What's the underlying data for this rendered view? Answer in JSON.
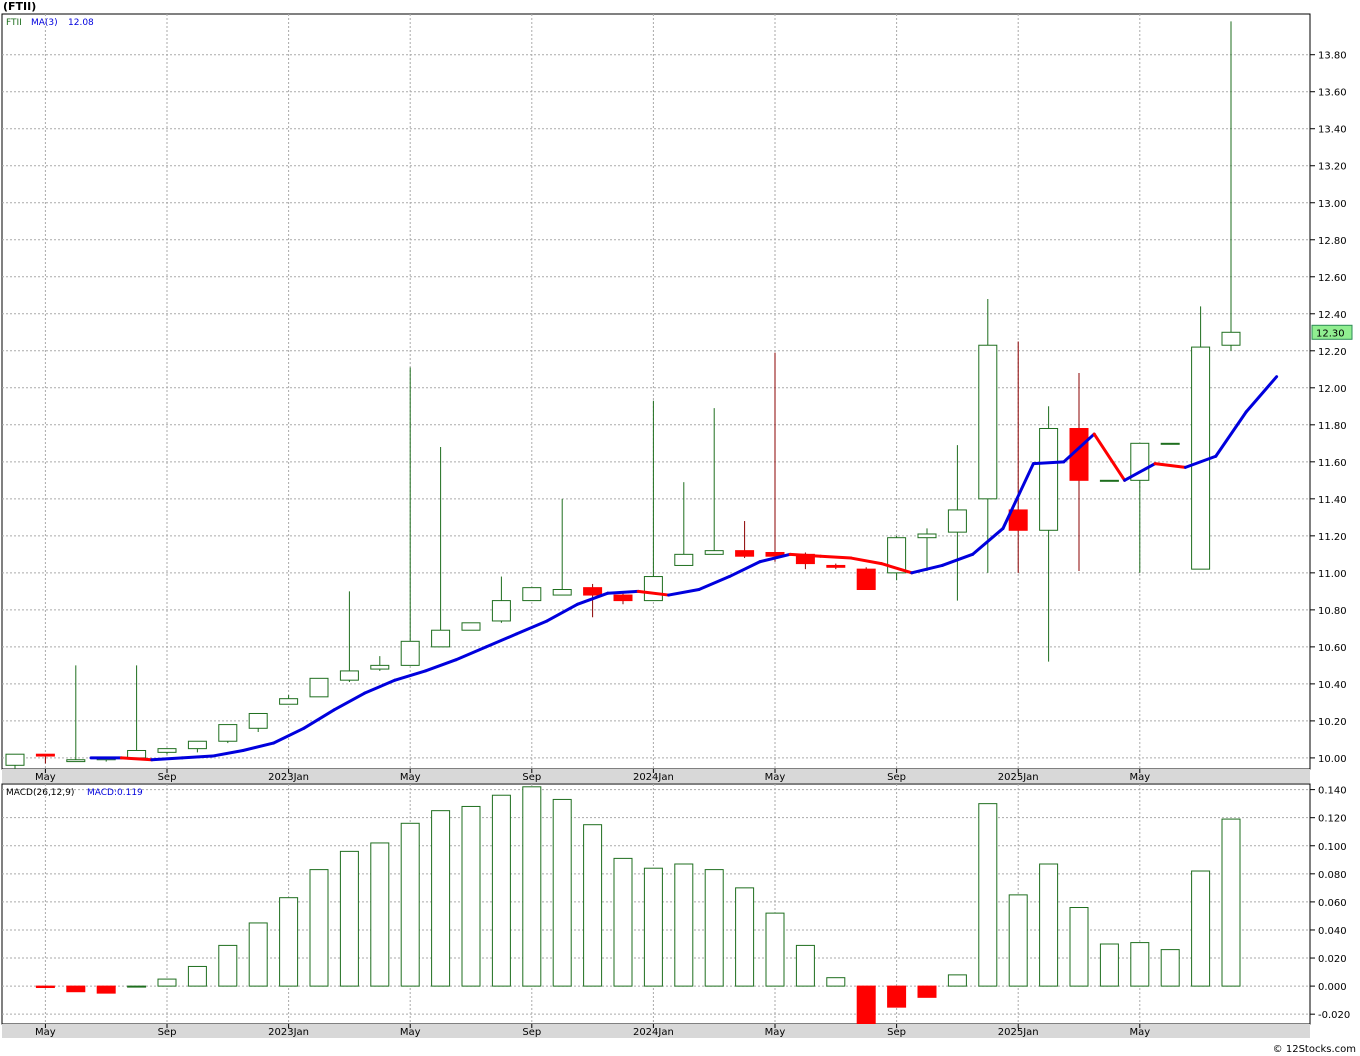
{
  "title": "(FTII)",
  "footer": "© 12Stocks.com",
  "colors": {
    "up_candle": "#1e6e1e",
    "down_candle": "#ff0000",
    "ma_up": "#0000dd",
    "ma_down": "#ff0000",
    "grid": "#aaaaaa",
    "axis_band": "#d8d8d8",
    "last_price_bg": "#90ee90"
  },
  "chart_data": [
    {
      "type": "candlestick",
      "legend": {
        "ticker": "FTII",
        "ma_label": "MA(3)",
        "ma_value": "12.08"
      },
      "last_price_label": "12.30",
      "ylim": [
        9.94,
        14.02
      ],
      "y_ticks": [
        10.0,
        10.2,
        10.4,
        10.6,
        10.8,
        11.0,
        11.2,
        11.4,
        11.6,
        11.8,
        12.0,
        12.2,
        12.4,
        12.6,
        12.8,
        13.0,
        13.2,
        13.4,
        13.6,
        13.8
      ],
      "x_labels": [
        {
          "label": "May",
          "index": 1
        },
        {
          "label": "Sep",
          "index": 5
        },
        {
          "label": "2023Jan",
          "index": 9
        },
        {
          "label": "May",
          "index": 13
        },
        {
          "label": "Sep",
          "index": 17
        },
        {
          "label": "2024Jan",
          "index": 21
        },
        {
          "label": "May",
          "index": 25
        },
        {
          "label": "Sep",
          "index": 29
        },
        {
          "label": "2025Jan",
          "index": 33
        },
        {
          "label": "May",
          "index": 37
        }
      ],
      "candles": [
        {
          "o": 9.96,
          "h": 10.02,
          "l": 9.94,
          "c": 10.02
        },
        {
          "o": 10.02,
          "h": 10.02,
          "l": 9.97,
          "c": 10.01
        },
        {
          "o": 9.98,
          "h": 10.5,
          "l": 9.98,
          "c": 9.99
        },
        {
          "o": 9.99,
          "h": 10.0,
          "l": 9.98,
          "c": 10.0
        },
        {
          "o": 10.0,
          "h": 10.5,
          "l": 10.0,
          "c": 10.04
        },
        {
          "o": 10.03,
          "h": 10.05,
          "l": 10.02,
          "c": 10.05
        },
        {
          "o": 10.05,
          "h": 10.09,
          "l": 10.03,
          "c": 10.09
        },
        {
          "o": 10.09,
          "h": 10.18,
          "l": 10.08,
          "c": 10.18
        },
        {
          "o": 10.16,
          "h": 10.24,
          "l": 10.14,
          "c": 10.24
        },
        {
          "o": 10.29,
          "h": 10.34,
          "l": 10.29,
          "c": 10.32
        },
        {
          "o": 10.33,
          "h": 10.43,
          "l": 10.33,
          "c": 10.43
        },
        {
          "o": 10.42,
          "h": 10.9,
          "l": 10.41,
          "c": 10.47
        },
        {
          "o": 10.48,
          "h": 10.55,
          "l": 10.47,
          "c": 10.5
        },
        {
          "o": 10.5,
          "h": 12.11,
          "l": 10.5,
          "c": 10.63
        },
        {
          "o": 10.6,
          "h": 11.68,
          "l": 10.6,
          "c": 10.69
        },
        {
          "o": 10.69,
          "h": 10.73,
          "l": 10.69,
          "c": 10.73
        },
        {
          "o": 10.74,
          "h": 10.98,
          "l": 10.73,
          "c": 10.85
        },
        {
          "o": 10.85,
          "h": 10.92,
          "l": 10.85,
          "c": 10.92
        },
        {
          "o": 10.88,
          "h": 11.4,
          "l": 10.88,
          "c": 10.91
        },
        {
          "o": 10.92,
          "h": 10.94,
          "l": 10.76,
          "c": 10.88
        },
        {
          "o": 10.88,
          "h": 10.9,
          "l": 10.83,
          "c": 10.85
        },
        {
          "o": 10.85,
          "h": 11.93,
          "l": 10.85,
          "c": 10.98
        },
        {
          "o": 11.04,
          "h": 11.49,
          "l": 11.04,
          "c": 11.1
        },
        {
          "o": 11.1,
          "h": 11.89,
          "l": 11.1,
          "c": 11.12
        },
        {
          "o": 11.12,
          "h": 11.28,
          "l": 11.08,
          "c": 11.09
        },
        {
          "o": 11.11,
          "h": 12.19,
          "l": 11.06,
          "c": 11.09
        },
        {
          "o": 11.1,
          "h": 11.11,
          "l": 11.02,
          "c": 11.05
        },
        {
          "o": 11.04,
          "h": 11.05,
          "l": 11.02,
          "c": 11.03
        },
        {
          "o": 11.02,
          "h": 11.03,
          "l": 10.91,
          "c": 10.91
        },
        {
          "o": 11.0,
          "h": 11.2,
          "l": 10.96,
          "c": 11.19
        },
        {
          "o": 11.19,
          "h": 11.24,
          "l": 11.01,
          "c": 11.21
        },
        {
          "o": 11.22,
          "h": 11.69,
          "l": 10.85,
          "c": 11.34
        },
        {
          "o": 11.4,
          "h": 12.48,
          "l": 11.0,
          "c": 12.23
        },
        {
          "o": 11.34,
          "h": 12.25,
          "l": 11.0,
          "c": 11.23
        },
        {
          "o": 11.23,
          "h": 11.9,
          "l": 10.52,
          "c": 11.78
        },
        {
          "o": 11.78,
          "h": 12.08,
          "l": 11.01,
          "c": 11.5
        },
        {
          "o": 11.5,
          "h": 11.5,
          "l": 11.5,
          "c": 11.5
        },
        {
          "o": 11.5,
          "h": 11.7,
          "l": 11.0,
          "c": 11.7
        },
        {
          "o": 11.7,
          "h": 11.7,
          "l": 11.7,
          "c": 11.7
        },
        {
          "o": 11.02,
          "h": 12.44,
          "l": 11.02,
          "c": 12.22
        },
        {
          "o": 12.23,
          "h": 13.98,
          "l": 12.2,
          "c": 12.3
        }
      ],
      "ma": [
        null,
        null,
        10.0,
        10.0,
        9.99,
        10.0,
        10.01,
        10.04,
        10.08,
        10.16,
        10.26,
        10.35,
        10.42,
        10.47,
        10.53,
        10.6,
        10.67,
        10.74,
        10.83,
        10.89,
        10.9,
        10.88,
        10.91,
        10.98,
        11.06,
        11.1,
        11.09,
        11.08,
        11.05,
        11.0,
        11.04,
        11.1,
        11.24,
        11.59,
        11.6,
        11.75,
        11.5,
        11.59,
        11.57,
        11.63,
        11.87,
        12.06
      ]
    },
    {
      "type": "bar",
      "legend": {
        "label": "MACD(26,12,9)",
        "value_label": "MACD:0.119"
      },
      "ylim": [
        -0.027,
        0.144
      ],
      "y_ticks": [
        -0.02,
        0.0,
        0.02,
        0.04,
        0.06,
        0.08,
        0.1,
        0.12,
        0.14
      ],
      "x_labels": [
        {
          "label": "May",
          "index": 1
        },
        {
          "label": "Sep",
          "index": 5
        },
        {
          "label": "2023Jan",
          "index": 9
        },
        {
          "label": "May",
          "index": 13
        },
        {
          "label": "Sep",
          "index": 17
        },
        {
          "label": "2024Jan",
          "index": 21
        },
        {
          "label": "May",
          "index": 25
        },
        {
          "label": "Sep",
          "index": 29
        },
        {
          "label": "2025Jan",
          "index": 33
        },
        {
          "label": "May",
          "index": 37
        }
      ],
      "values": [
        null,
        -0.001,
        -0.004,
        -0.005,
        0.0,
        0.005,
        0.014,
        0.029,
        0.045,
        0.063,
        0.083,
        0.096,
        0.102,
        0.116,
        0.125,
        0.128,
        0.136,
        0.142,
        0.133,
        0.115,
        0.091,
        0.084,
        0.087,
        0.083,
        0.07,
        0.052,
        0.029,
        0.006,
        -0.027,
        -0.015,
        -0.008,
        0.008,
        0.13,
        0.065,
        0.087,
        0.056,
        0.03,
        0.031,
        0.026,
        0.082,
        0.119
      ]
    }
  ]
}
